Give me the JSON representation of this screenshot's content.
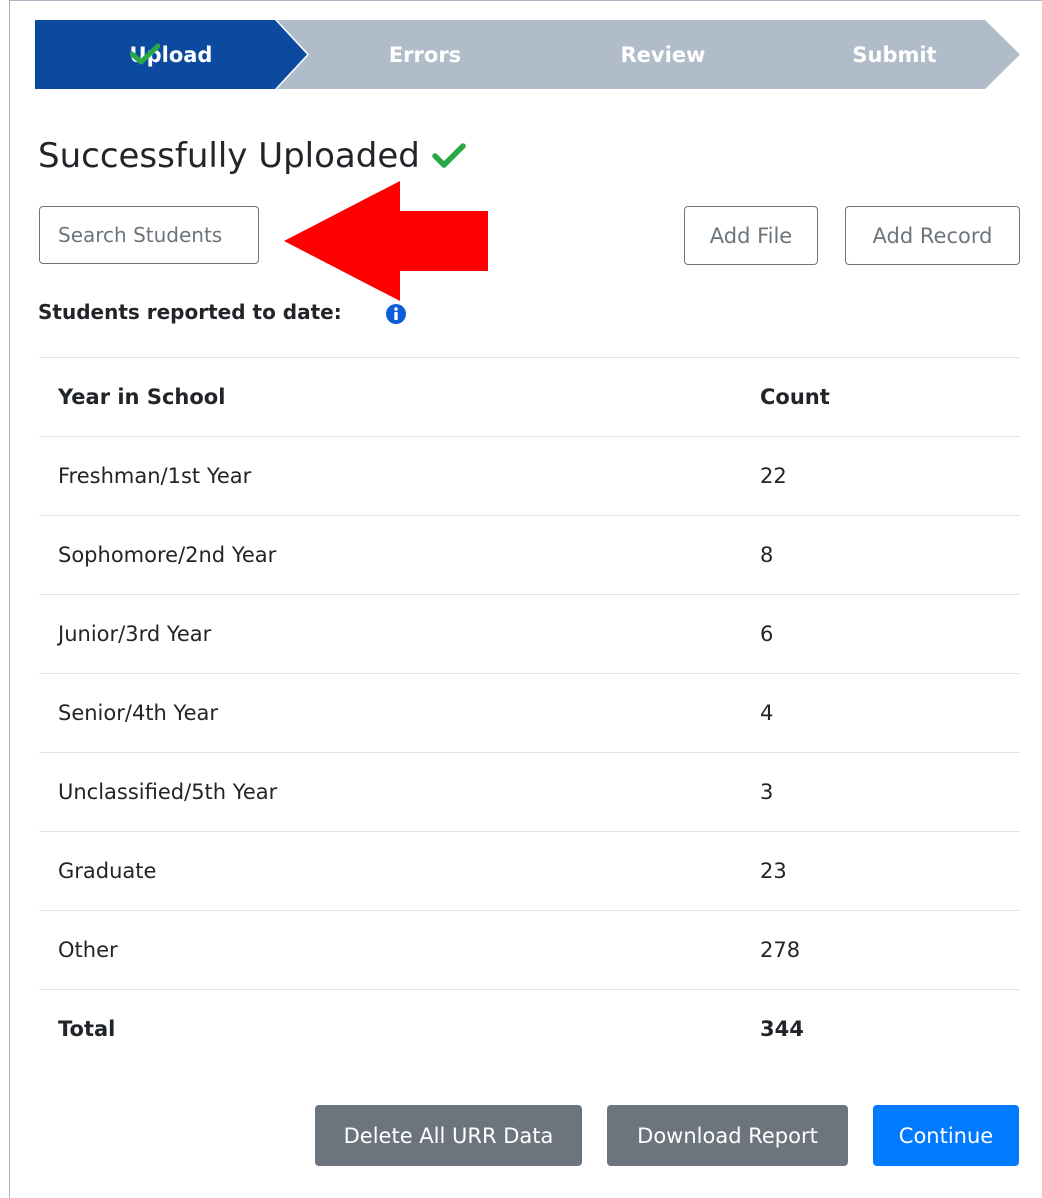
{
  "stepper": {
    "steps": [
      {
        "label": "Upload",
        "state": "complete"
      },
      {
        "label": "Errors",
        "state": "pending"
      },
      {
        "label": "Review",
        "state": "pending"
      },
      {
        "label": "Submit",
        "state": "pending"
      }
    ],
    "active_color": "#0b4a9e",
    "inactive_color": "#b1bccb",
    "check_color": "#28a745"
  },
  "heading": {
    "title": "Successfully Uploaded",
    "icon": "check-icon"
  },
  "search": {
    "placeholder": "Search Students",
    "value": ""
  },
  "toolbar": {
    "add_file_label": "Add File",
    "add_record_label": "Add Record"
  },
  "annotation": {
    "icon": "arrow-left-icon",
    "color": "#ff0000"
  },
  "reported": {
    "label": "Students reported to date:",
    "info_icon": "info-icon",
    "info_color": "#0b5ed7"
  },
  "table": {
    "headers": [
      "Year in School",
      "Count"
    ],
    "rows": [
      [
        "Freshman/1st Year",
        "22"
      ],
      [
        "Sophomore/2nd Year",
        "8"
      ],
      [
        "Junior/3rd Year",
        "6"
      ],
      [
        "Senior/4th Year",
        "4"
      ],
      [
        "Unclassified/5th Year",
        "3"
      ],
      [
        "Graduate",
        "23"
      ],
      [
        "Other",
        "278"
      ]
    ],
    "total": [
      "Total",
      "344"
    ]
  },
  "actions": {
    "delete_label": "Delete All URR Data",
    "download_label": "Download Report",
    "continue_label": "Continue"
  }
}
